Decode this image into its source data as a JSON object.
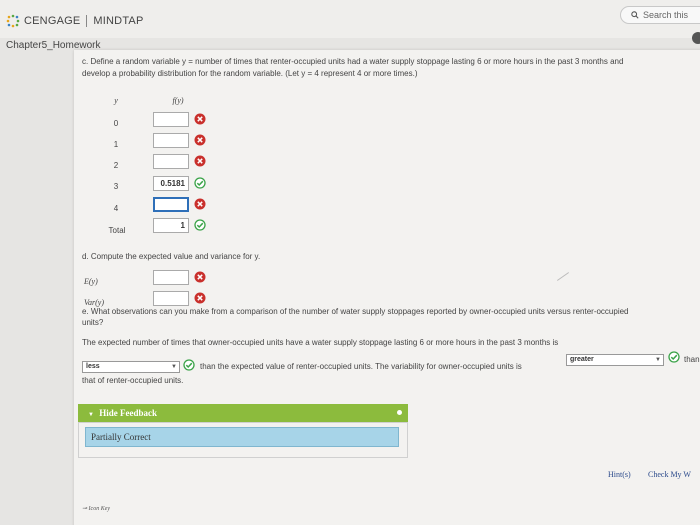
{
  "header": {
    "brand": "CENGAGE",
    "product": "MINDTAP",
    "search_placeholder": "Search this"
  },
  "breadcrumb": "Chapter5_Homework",
  "part_c": {
    "line1": "c. Define a random variable y = number of times that renter-occupied units had a water supply stoppage lasting 6 or more hours in the past 3 months and",
    "line2": "develop a probability distribution for the random variable. (Let y = 4 represent 4 or more times.)",
    "col_y": "y",
    "col_fy": "f(y)",
    "rows": [
      {
        "y": "0",
        "value": "",
        "status": "incorrect"
      },
      {
        "y": "1",
        "value": "",
        "status": "incorrect"
      },
      {
        "y": "2",
        "value": "",
        "status": "incorrect"
      },
      {
        "y": "3",
        "value": "0.5181",
        "status": "correct"
      },
      {
        "y": "4",
        "value": "",
        "status": "incorrect"
      },
      {
        "y": "Total",
        "value": "1",
        "status": "correct"
      }
    ]
  },
  "part_d": {
    "prompt": "d. Compute the expected value and variance for y.",
    "ey_label": "E(y)",
    "vary_label": "Var(y)"
  },
  "part_e": {
    "line1": "e. What observations can you make from a comparison of the number of water supply stoppages reported by owner-occupied units versus renter-occupied",
    "line2": "units?",
    "statement": "The expected number of times that owner-occupied units have a water supply stoppage lasting 6 or more hours in the past 3 months is",
    "select1": "less",
    "mid_text": "than the expected value of renter-occupied units. The variability for owner-occupied units is",
    "select2": "greater",
    "tail_text": "than",
    "end_text": "that of renter-occupied units."
  },
  "feedback": {
    "header": "Hide Feedback",
    "result": "Partially Correct"
  },
  "footer": {
    "hints": "Hint(s)",
    "check": "Check My W",
    "icon_key": "Icon Key"
  },
  "colors": {
    "correct": "#3aa348",
    "incorrect": "#c9302c",
    "feedback_bar": "#8cbb3d",
    "feedback_box": "#a7d4e8"
  }
}
